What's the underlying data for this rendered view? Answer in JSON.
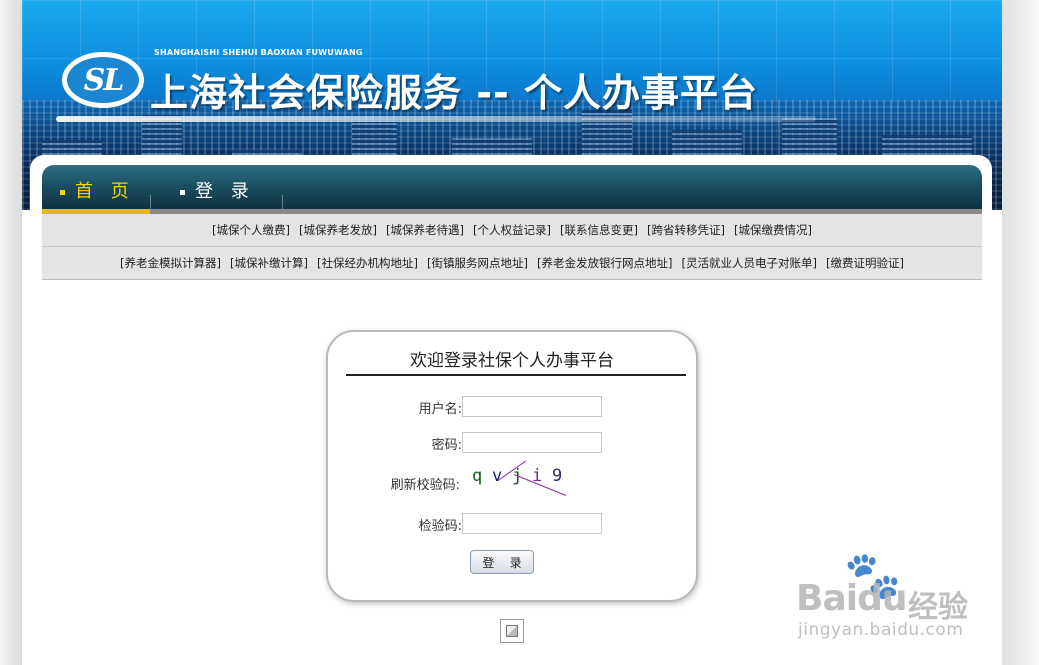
{
  "banner": {
    "logo": "SL",
    "subtitle": "SHANGHAISHI SHEHUI BAOXIAN FUWUWANG",
    "title": "上海社会保险服务 -- 个人办事平台"
  },
  "nav": {
    "items": [
      {
        "label": "首 页",
        "active": true
      },
      {
        "label": "登 录",
        "active": false
      }
    ],
    "links_row1": [
      "[城保个人缴费]",
      "[城保养老发放]",
      "[城保养老待遇]",
      "[个人权益记录]",
      "[联系信息变更]",
      "[跨省转移凭证]",
      "[城保缴费情况]"
    ],
    "links_row2": [
      "[养老金模拟计算器]",
      "[城保补缴计算]",
      "[社保经办机构地址]",
      "[街镇服务网点地址]",
      "[养老金发放银行网点地址]",
      "[灵活就业人员电子对账单]",
      "[缴费证明验证]"
    ]
  },
  "login": {
    "title": "欢迎登录社保个人办事平台",
    "username_label": "用户名:",
    "username_value": "",
    "password_label": "密码:",
    "password_value": "",
    "refresh_captcha_label": "刷新校验码:",
    "captcha_chars": [
      "q",
      "v",
      "j",
      "i",
      "9"
    ],
    "captcha_input_label": "检验码:",
    "captcha_input_value": "",
    "submit_label": "登 录"
  },
  "watermark": {
    "paw": "🐾",
    "brand": "Bai",
    "brand2": "du",
    "cn": "经验",
    "url": "jingyan.baidu.com"
  },
  "colors": {
    "nav_active": "#f2d500",
    "captcha": [
      "#1a5c1a",
      "#1c1c8a",
      "#1a4a1a",
      "#7a2a8a",
      "#2a2a6a"
    ]
  }
}
